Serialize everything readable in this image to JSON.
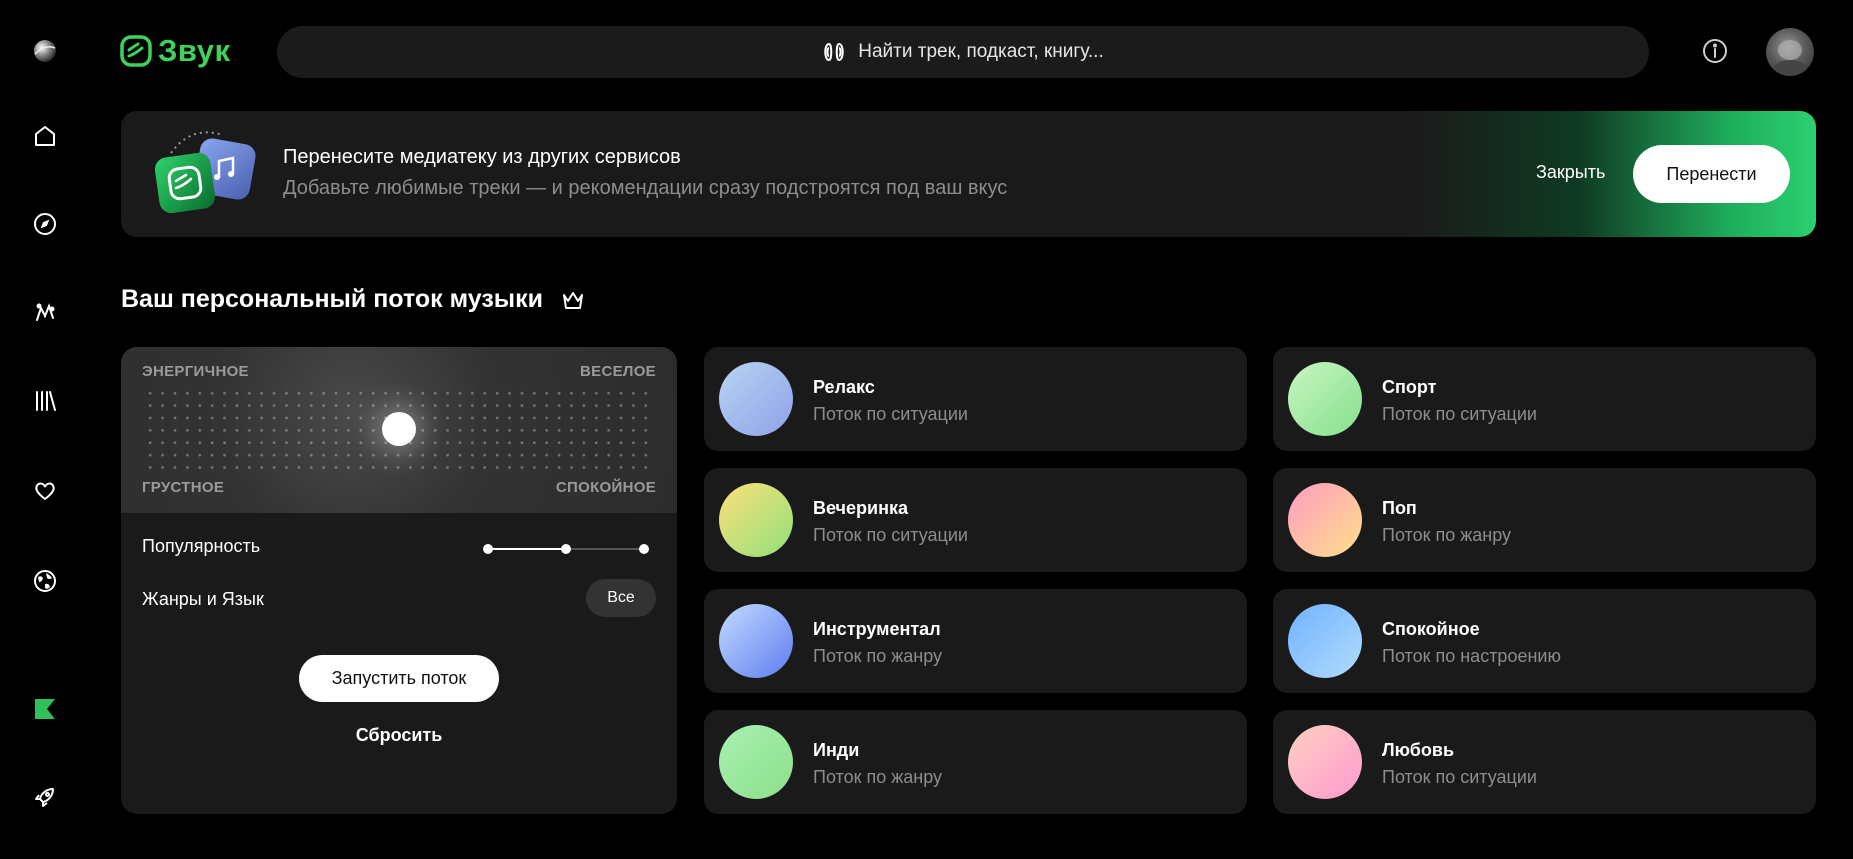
{
  "app": {
    "logo_text": "Звук",
    "brand_color": "#3fd25a"
  },
  "search": {
    "placeholder": "Найти трек, подкаст, книгу..."
  },
  "sidebar": {
    "items": [
      {
        "icon": "profile-sphere-icon"
      },
      {
        "icon": "home-icon"
      },
      {
        "icon": "compass-icon"
      },
      {
        "icon": "kids-icon"
      },
      {
        "icon": "library-icon"
      },
      {
        "icon": "heart-icon"
      },
      {
        "icon": "globe-icon"
      },
      {
        "icon": "flag-icon"
      },
      {
        "icon": "rocket-icon"
      }
    ]
  },
  "banner": {
    "title": "Перенесите медиатеку из других сервисов",
    "subtitle": "Добавьте любимые треки — и рекомендации сразу подстроятся под ваш вкус",
    "close_label": "Закрыть",
    "transfer_label": "Перенести"
  },
  "section": {
    "title": "Ваш персональный поток музыки",
    "icon": "crown-icon"
  },
  "mood": {
    "top_left": "ЭНЕРГИЧНОЕ",
    "top_right": "ВЕСЕЛОЕ",
    "bottom_left": "ГРУСТНОЕ",
    "bottom_right": "СПОКОЙНОЕ",
    "popularity_label": "Популярность",
    "popularity_level": 0.5,
    "genres_label": "Жанры и Язык",
    "genres_value": "Все",
    "start_label": "Запустить поток",
    "reset_label": "Сбросить"
  },
  "stations": [
    {
      "title": "Релакс",
      "subtitle": "Поток по ситуации"
    },
    {
      "title": "Спорт",
      "subtitle": "Поток по ситуации"
    },
    {
      "title": "Вечеринка",
      "subtitle": "Поток по ситуации"
    },
    {
      "title": "Поп",
      "subtitle": "Поток по жанру"
    },
    {
      "title": "Инструментал",
      "subtitle": "Поток по жанру"
    },
    {
      "title": "Спокойное",
      "subtitle": "Поток по настроению"
    },
    {
      "title": "Инди",
      "subtitle": "Поток по жанру"
    },
    {
      "title": "Любовь",
      "subtitle": "Поток по ситуации"
    }
  ]
}
